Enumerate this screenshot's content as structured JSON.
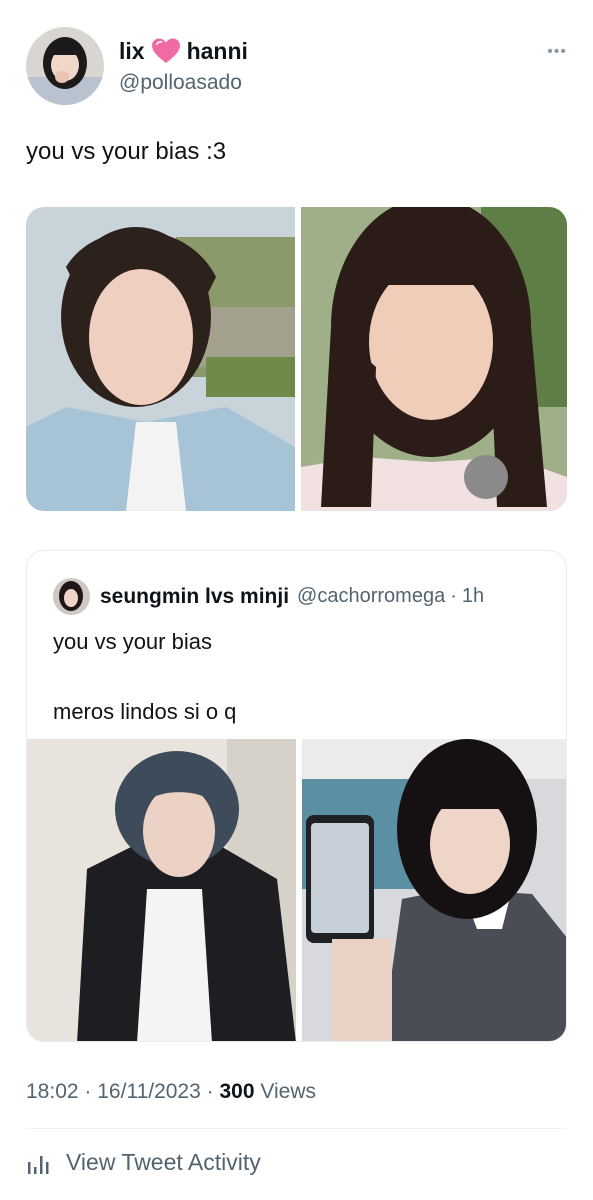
{
  "tweet": {
    "author": {
      "name_left": "lix",
      "name_right": "hanni",
      "handle": "@polloasado"
    },
    "text": "you vs your bias :3",
    "media": [
      {
        "label": "selfie of a young man in a light blue jacket outdoors"
      },
      {
        "label": "selfie of a young woman with bangs winking"
      }
    ]
  },
  "quote": {
    "author": {
      "name": "seungmin lvs minji",
      "handle": "@cachorromega",
      "time": "1h"
    },
    "separator": "·",
    "line1": "you vs your bias",
    "line2": "meros lindos si o q",
    "media": [
      {
        "label": "young man with blue-gray hair in a black blazer"
      },
      {
        "label": "young woman holding a phone in a mirror selfie"
      }
    ]
  },
  "meta": {
    "time": "18:02",
    "date": "16/11/2023",
    "views_count": "300",
    "views_label": "Views",
    "separator": "·"
  },
  "actions": {
    "view_activity": "View Tweet Activity"
  },
  "colors": {
    "text": "#0f1419",
    "secondary": "#536471",
    "heart": "#f06aa4",
    "border": "#e6ecf0"
  }
}
